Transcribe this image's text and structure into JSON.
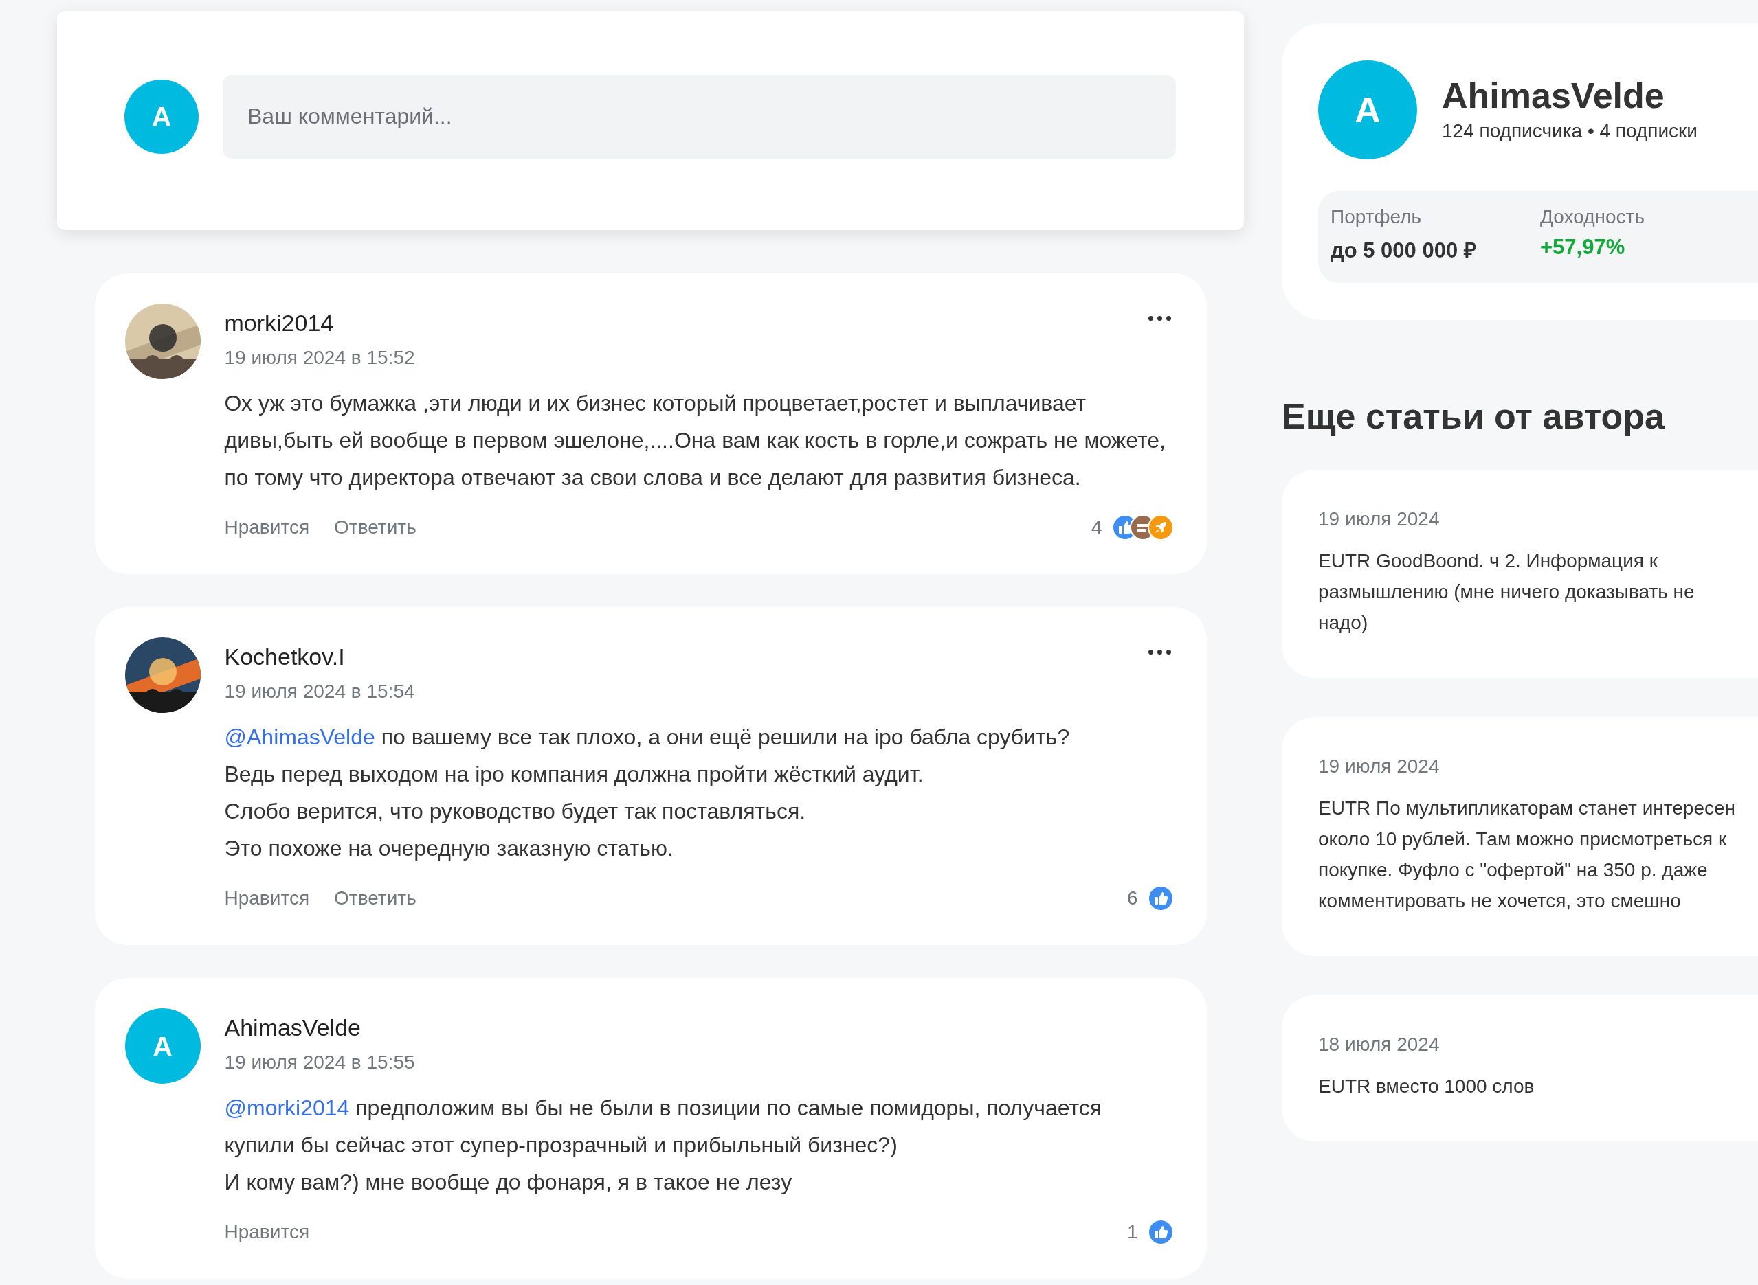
{
  "composer": {
    "avatar_letter": "A",
    "placeholder": "Ваш комментарий..."
  },
  "comments": [
    {
      "author": "morki2014",
      "avatar": {
        "kind": "picture"
      },
      "date": "19 июля 2024 в 15:52",
      "paragraphs": [
        {
          "text": "Ох уж это бумажка ,эти люди и их бизнес который процветает,ростет и выплачивает дивы,быть ей вообще в первом эшелоне,....Она вам как кость в горле,и сожрать не можете, по тому что директора отвечают за свои слова и все делают для развития бизнеса."
        }
      ],
      "actions": [
        "Нравится",
        "Ответить"
      ],
      "has_menu": true,
      "reaction_count": "4",
      "reactions": [
        {
          "kind": "like"
        },
        {
          "kind": "brown"
        },
        {
          "kind": "rocket"
        }
      ]
    },
    {
      "author": "Kochetkov.I",
      "avatar": {
        "kind": "picture"
      },
      "date": "19 июля 2024 в 15:54",
      "paragraphs": [
        {
          "mention": "@AhimasVelde",
          "text": " по вашему все так плохо, а они ещё решили на ipo бабла срубить?"
        },
        {
          "text": "Ведь перед выходом на ipo компания должна пройти жёсткий аудит."
        },
        {
          "text": "Слобо верится, что руководство будет так поставляться."
        },
        {
          "text": "Это похоже на очередную заказную статью."
        }
      ],
      "actions": [
        "Нравится",
        "Ответить"
      ],
      "has_menu": true,
      "reaction_count": "6",
      "reactions": [
        {
          "kind": "like"
        }
      ]
    },
    {
      "author": "AhimasVelde",
      "avatar": {
        "kind": "letter",
        "letter": "A"
      },
      "date": "19 июля 2024 в 15:55",
      "paragraphs": [
        {
          "mention": "@morki2014",
          "text": " предположим вы бы не были в позиции по самые помидоры, получается купили бы сейчас этот супер-прозрачный и прибыльный бизнес?)"
        },
        {
          "text": "И кому вам?) мне вообще до фонаря, я в такое не лезу"
        }
      ],
      "actions": [
        "Нравится"
      ],
      "has_menu": false,
      "reaction_count": "1",
      "reactions": [
        {
          "kind": "like"
        }
      ]
    }
  ],
  "profile": {
    "avatar_letter": "A",
    "name": "AhimasVelde",
    "followers": "124 подписчика",
    "separator": "•",
    "following": "4 подписки",
    "stats": [
      {
        "label": "Портфель",
        "value": "до 5 000 000 ₽",
        "kind": "neutral"
      },
      {
        "label": "Доходность",
        "value": "+57,97%",
        "kind": "positive"
      }
    ]
  },
  "more_articles": {
    "title": "Еще статьи от автора",
    "items": [
      {
        "date": "19 июля 2024",
        "title": "EUTR GoodBoond. ч 2. Информация к размышлению (мне ничего доказывать не надо)"
      },
      {
        "date": "19 июля 2024",
        "title": "EUTR По мультипликаторам станет интересен около 10 рублей. Там можно присмотреться к покупке. Фуфло с \"офертой\" на 350 р. даже комментировать не хочется, это смешно"
      },
      {
        "date": "18 июля 2024",
        "title": "EUTR вместо 1000 слов"
      }
    ]
  }
}
